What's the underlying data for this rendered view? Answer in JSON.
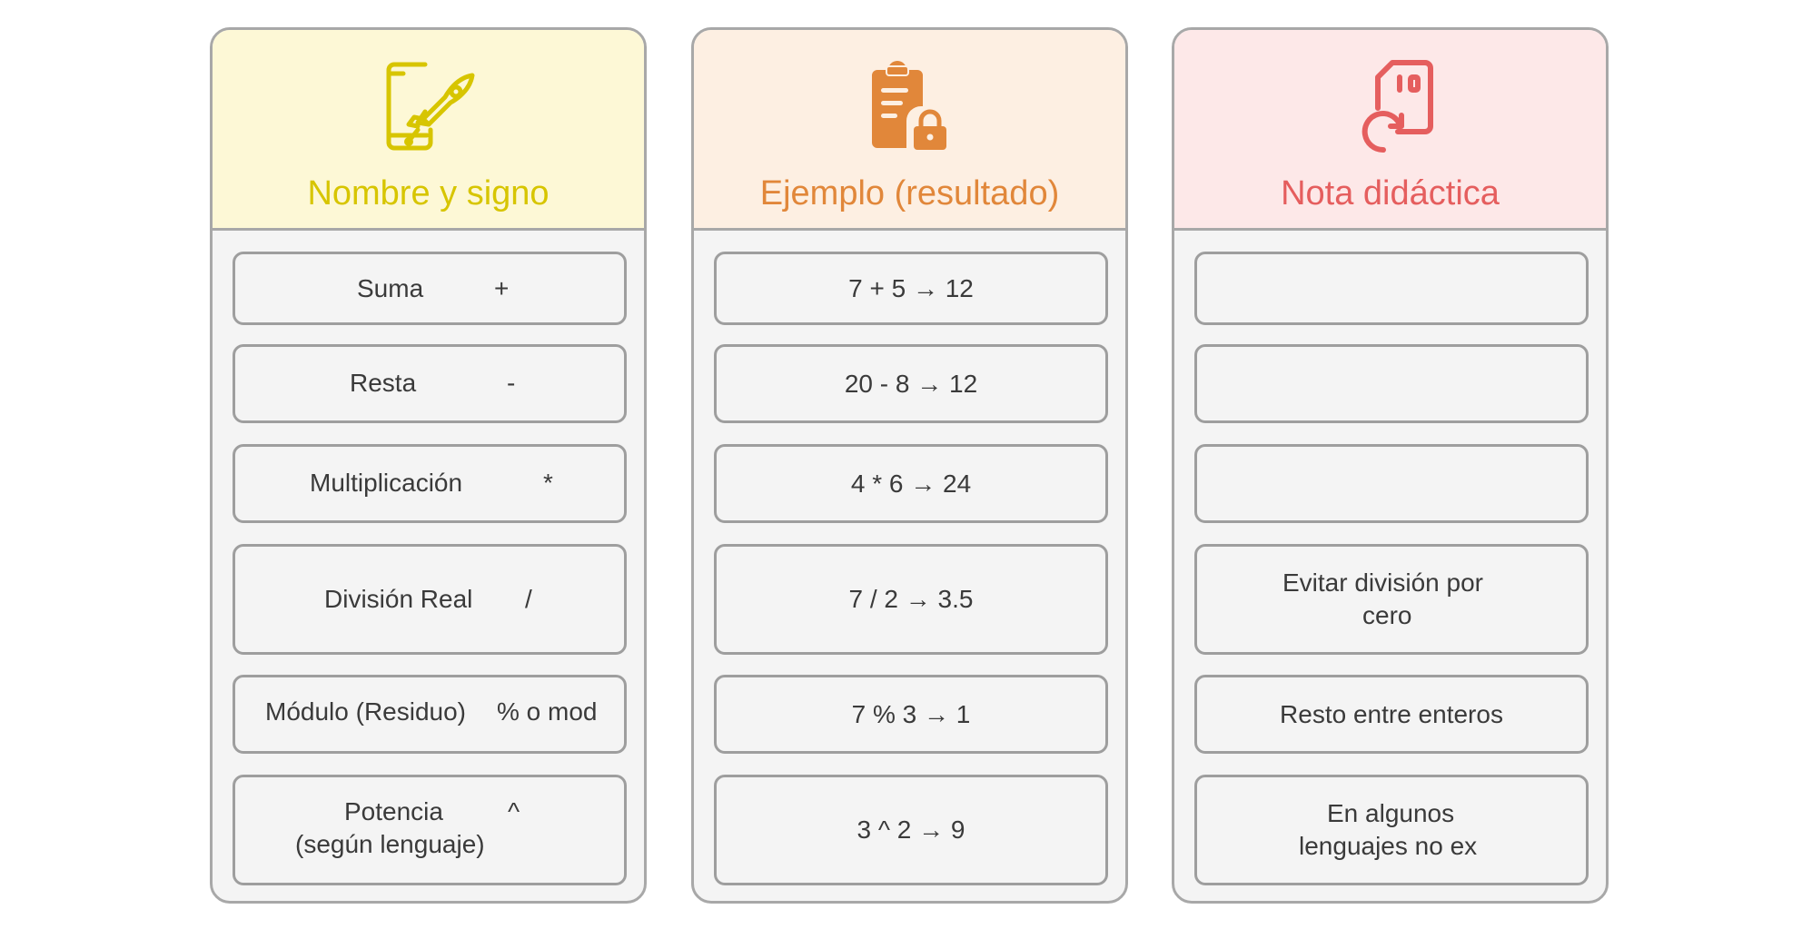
{
  "columns": [
    {
      "title": "Nombre y signo",
      "color": "#d7c500",
      "icon": "phone-rocket-icon",
      "rows": [
        {
          "name": "Suma",
          "sign": "+"
        },
        {
          "name": "Resta",
          "sign": "-"
        },
        {
          "name": "Multiplicación",
          "sign": "*"
        },
        {
          "name": "División Real",
          "sign": "/"
        },
        {
          "name": "Módulo (Residuo)",
          "sign": "% o mod"
        },
        {
          "name_line1": "Potencia",
          "name_line2": "(según lenguaje)",
          "sign": "^"
        }
      ]
    },
    {
      "title": "Ejemplo (resultado)",
      "color": "#e1873a",
      "icon": "clipboard-lock-icon",
      "rows": [
        "7 + 5 → 12",
        "20 - 8 → 12",
        "4 * 6 → 24",
        "7 / 2 → 3.5",
        "7 % 3 → 1",
        "3 ^ 2 → 9"
      ]
    },
    {
      "title": "Nota didáctica",
      "color": "#e55e5e",
      "icon": "sd-card-refresh-icon",
      "rows": [
        "",
        "",
        "",
        {
          "line1": "Evitar división por",
          "line2": "cero"
        },
        "Resto entre enteros",
        {
          "line1": "En algunos",
          "line2": "lenguajes no ex"
        }
      ]
    }
  ]
}
